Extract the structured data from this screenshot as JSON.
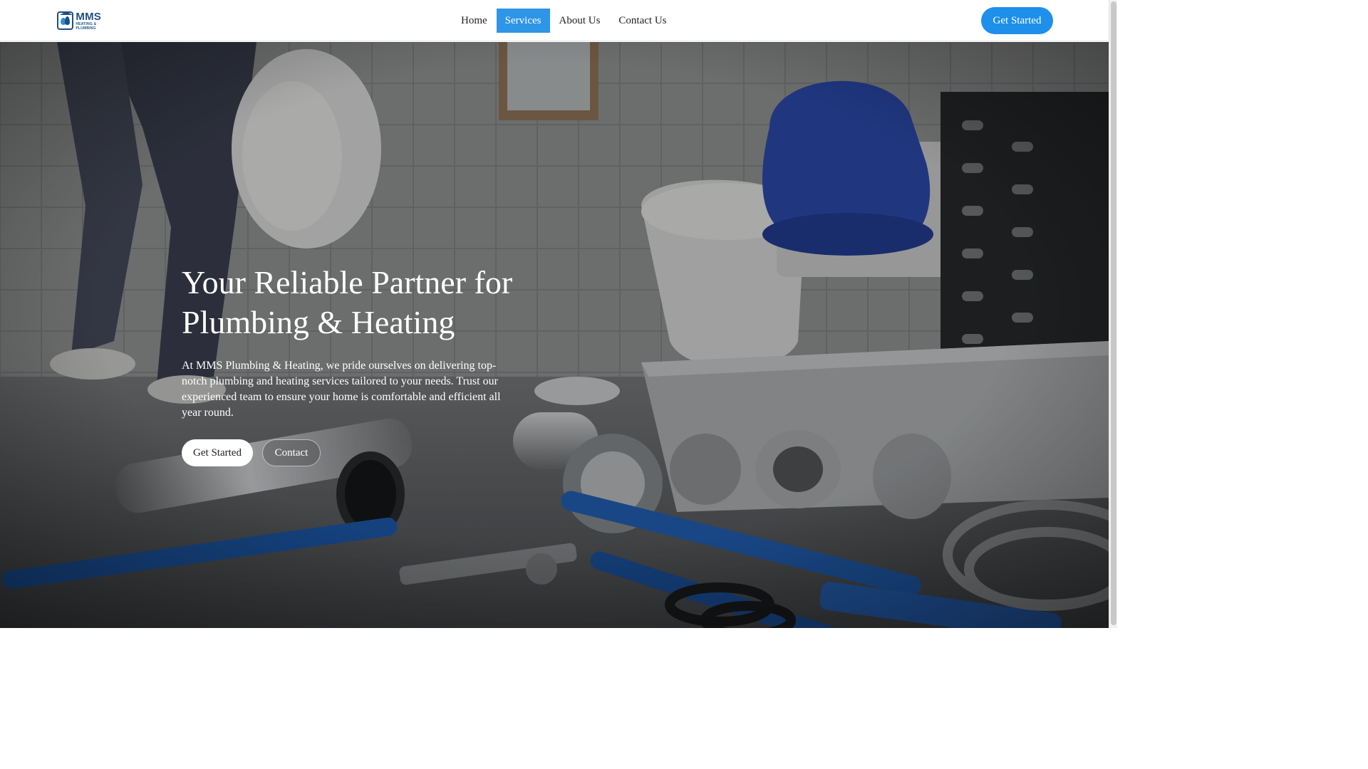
{
  "brand": {
    "logo_big": "MMS",
    "logo_small_line1": "HEATING &",
    "logo_small_line2": "PLUMBING"
  },
  "nav": {
    "items": [
      {
        "label": "Home"
      },
      {
        "label": "Services",
        "active": true
      },
      {
        "label": "About Us"
      },
      {
        "label": "Contact Us"
      }
    ]
  },
  "header": {
    "cta_label": "Get Started"
  },
  "hero": {
    "title_line1": "Your Reliable Partner for",
    "title_line2": "Plumbing & Heating",
    "text": "At MMS Plumbing & Heating, we pride ourselves on delivering top-notch plumbing and heating services tailored to your needs. Trust our experienced team to ensure your home is comfortable and efficient all year round.",
    "primary_button": "Get Started",
    "secondary_button": "Contact"
  },
  "colors": {
    "accent": "#1e8fea",
    "nav_active": "#2f95e6",
    "brand": "#1f4f82"
  }
}
